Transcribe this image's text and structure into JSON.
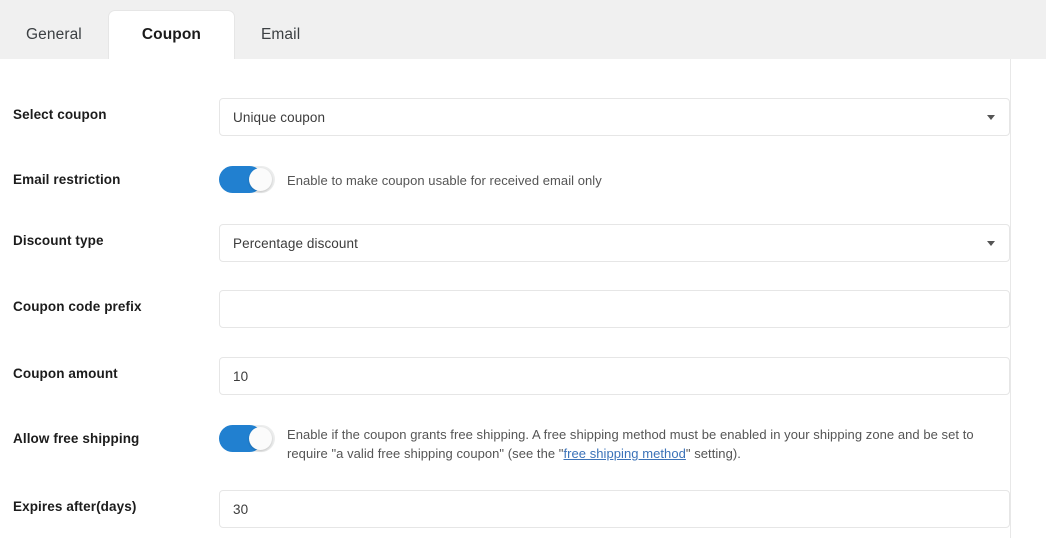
{
  "tabs": [
    {
      "label": "General",
      "active": false
    },
    {
      "label": "Coupon",
      "active": true
    },
    {
      "label": "Email",
      "active": false
    }
  ],
  "form": {
    "select_coupon": {
      "label": "Select coupon",
      "value": "Unique coupon",
      "caret": "chevron-down-icon"
    },
    "email_restriction": {
      "label": "Email restriction",
      "toggle_state": "on",
      "helper": "Enable to make coupon usable for received email only"
    },
    "discount_type": {
      "label": "Discount type",
      "value": "Percentage discount",
      "caret": "chevron-down-icon"
    },
    "coupon_code_prefix": {
      "label": "Coupon code prefix",
      "value": "",
      "placeholder": ""
    },
    "coupon_amount": {
      "label": "Coupon amount",
      "value": "10"
    },
    "allow_free_shipping": {
      "label": "Allow free shipping",
      "toggle_state": "on",
      "helper_part1": "Enable if the coupon grants free shipping. A free shipping method must be enabled in your shipping zone and be set to require \"a valid free shipping coupon\" (see the \"",
      "helper_link": "free shipping method",
      "helper_part2": "\" setting)."
    },
    "expires_after": {
      "label": "Expires after(days)",
      "value": "30"
    }
  },
  "colors": {
    "toggle_on": "#2180d0",
    "link": "#3b72b8",
    "tabbar_bg": "#f0f0f0",
    "field_border": "#e6e6e6"
  }
}
